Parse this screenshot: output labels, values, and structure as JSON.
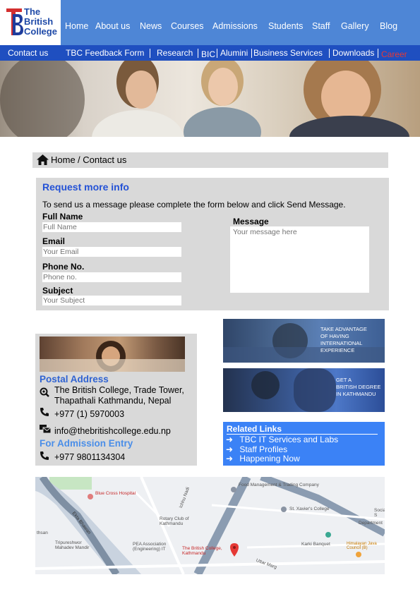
{
  "logo": {
    "line1": "The",
    "line2": "British",
    "line3": "College"
  },
  "nav": [
    "Home",
    "About us",
    "News",
    "Courses",
    "Admissions",
    "Students",
    "Staff",
    "Gallery",
    "Blog"
  ],
  "subnav": [
    "Contact us",
    "TBC Feedback Form",
    "Research",
    "BIC",
    "Alumini",
    "Business Services",
    "Downloads",
    "Career"
  ],
  "breadcrumb": {
    "home": "Home",
    "current": "/ Contact us"
  },
  "form": {
    "title": "Request more info",
    "intro": "To send us a message please complete the form below and click Send Message.",
    "full_name_label": "Full Name",
    "full_name_placeholder": "Full Name",
    "email_label": "Email",
    "email_placeholder": "Your Email",
    "phone_label": "Phone No.",
    "phone_placeholder": "Phone no.",
    "subject_label": "Subject",
    "subject_placeholder": "Your Subject",
    "message_label": "Message",
    "message_placeholder": "Your message here"
  },
  "address": {
    "title": "Postal Address",
    "line1": "The British College, Trade Tower,",
    "line2": "Thapathali Kathmandu, Nepal",
    "phone": "+977 (1) 5970003",
    "email": "info@thebritishcollege.edu.np",
    "admission_title": "For Admission Entry",
    "admission_phone": "+977 9801134304"
  },
  "banners": [
    {
      "line1": "Take advantage",
      "line2": "of having",
      "line3": "international",
      "line4": "experience"
    },
    {
      "line1": "Get a",
      "line2": "British degree",
      "line3": "in Kathmandu"
    }
  ],
  "related": {
    "title": "Related Links",
    "items": [
      "TBC IT Services and Labs",
      "Staff Profiles",
      "Happening Now"
    ]
  },
  "map": {
    "labels": [
      "Blue Cross Hospital",
      "Food Management & Trading Company",
      "St. Xavier's College",
      "Rotary Club of Kathmandu",
      "PEA Association (Engineering) IT",
      "The British College, Kathmandu",
      "Karki Banquet",
      "Himalayan Java Council (B)",
      "Department",
      "Social S",
      "Tripureshwor Mahadev Mandir",
      "thsan",
      "Ichhu Nadi",
      "Ekta Bhawan",
      "Uttar Marg"
    ]
  },
  "colors": {
    "nav_bg": "#4e86d6",
    "subnav_bg": "#1f4fc0",
    "accent": "#2452d6",
    "panel": "#d9d9d9",
    "career": "#e53935"
  }
}
